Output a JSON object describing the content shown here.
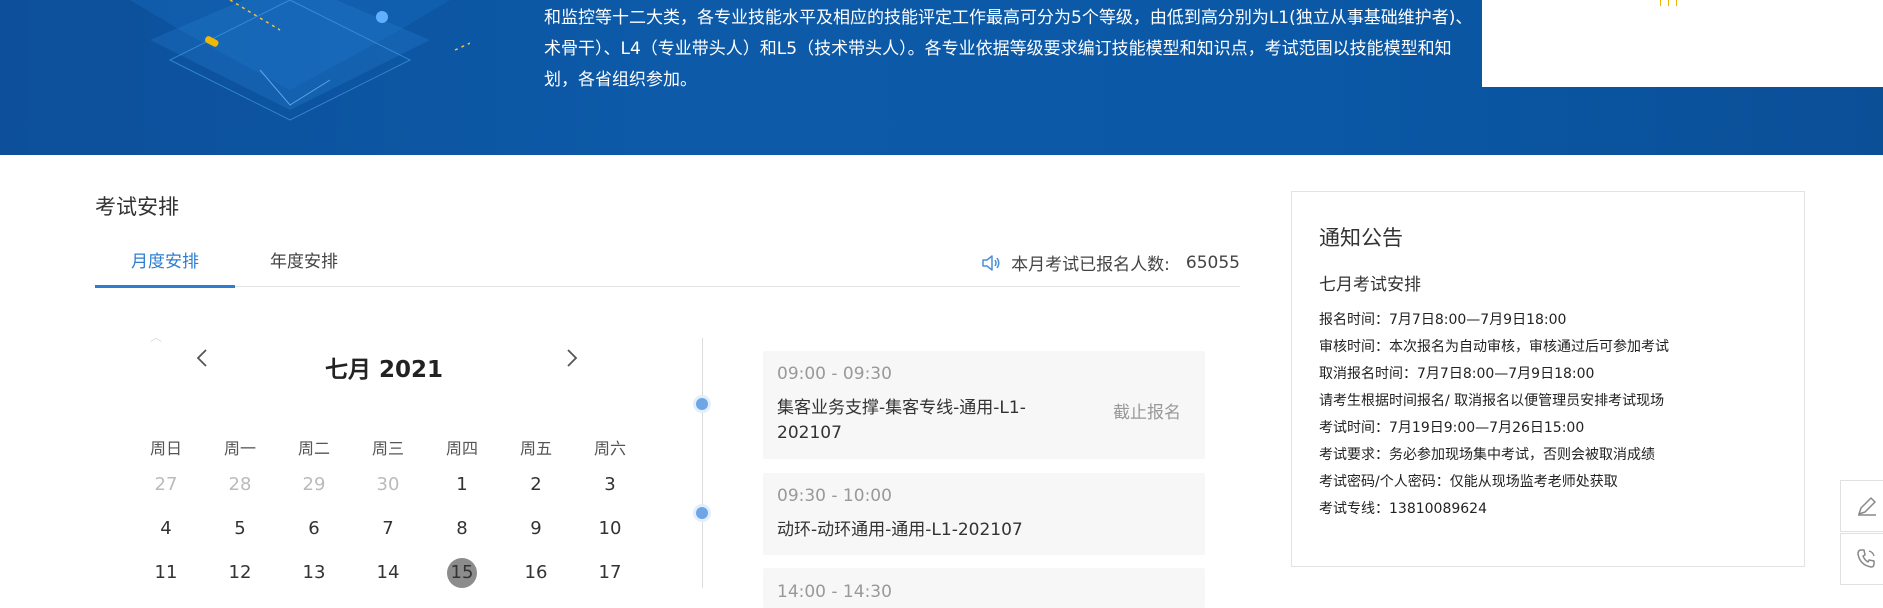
{
  "banner": {
    "lines": [
      "和监控等十二大类，各专业技能水平及相应的技能评定工作最高可分为5个等级，由低到高分别为L1(独立从事基础维护者)、",
      "术骨干）、L4（专业带头人）和L5（技术带头人）。各专业依据等级要求编订技能模型和知识点，考试范围以技能模型和知",
      "划，各省组织参加。"
    ]
  },
  "exam": {
    "title": "考试安排",
    "tabs": [
      "月度安排",
      "年度安排"
    ],
    "registration_label": "本月考试已报名人数:",
    "registration_count": "65055"
  },
  "calendar": {
    "month_title": "七月 2021",
    "weekdays": [
      "周日",
      "周一",
      "周二",
      "周三",
      "周四",
      "周五",
      "周六"
    ],
    "rows": [
      [
        "27",
        "28",
        "29",
        "30",
        "1",
        "2",
        "3"
      ],
      [
        "4",
        "5",
        "6",
        "7",
        "8",
        "9",
        "10"
      ],
      [
        "11",
        "12",
        "13",
        "14",
        "15",
        "16",
        "17"
      ]
    ],
    "today": "15"
  },
  "schedule": [
    {
      "time": "09:00 - 09:30",
      "name": "集客业务支撑-集客专线-通用-L1-202107",
      "status": "截止报名"
    },
    {
      "time": "09:30 - 10:00",
      "name": "动环-动环通用-通用-L1-202107",
      "status": ""
    },
    {
      "time": "14:00 - 14:30",
      "name": "",
      "status": ""
    }
  ],
  "notice": {
    "title": "通知公告",
    "subtitle": "七月考试安排",
    "lines": [
      "报名时间：7月7日8:00—7月9日18:00",
      "审核时间：本次报名为自动审核，审核通过后可参加考试",
      "取消报名时间：7月7日8:00—7月9日18:00",
      "请考生根据时间报名/ 取消报名以便管理员安排考试现场",
      "考试时间：7月19日9:00—7月26日15:00",
      "考试要求：务必参加现场集中考试，否则会被取消成绩",
      "考试密码/个人密码：仅能从现场监考老师处获取",
      "考试专线：13810089624"
    ]
  },
  "icons": {
    "speaker": "speaker-icon",
    "prev": "chevron-left-icon",
    "next": "chevron-right-icon",
    "edit": "pencil-icon",
    "phone": "phone-icon"
  },
  "colors": {
    "banner": "#0c5aa8",
    "accent": "#2d7dd2",
    "today_circle": "#8c8c8c",
    "timeline_dot": "#6ea5e6"
  }
}
